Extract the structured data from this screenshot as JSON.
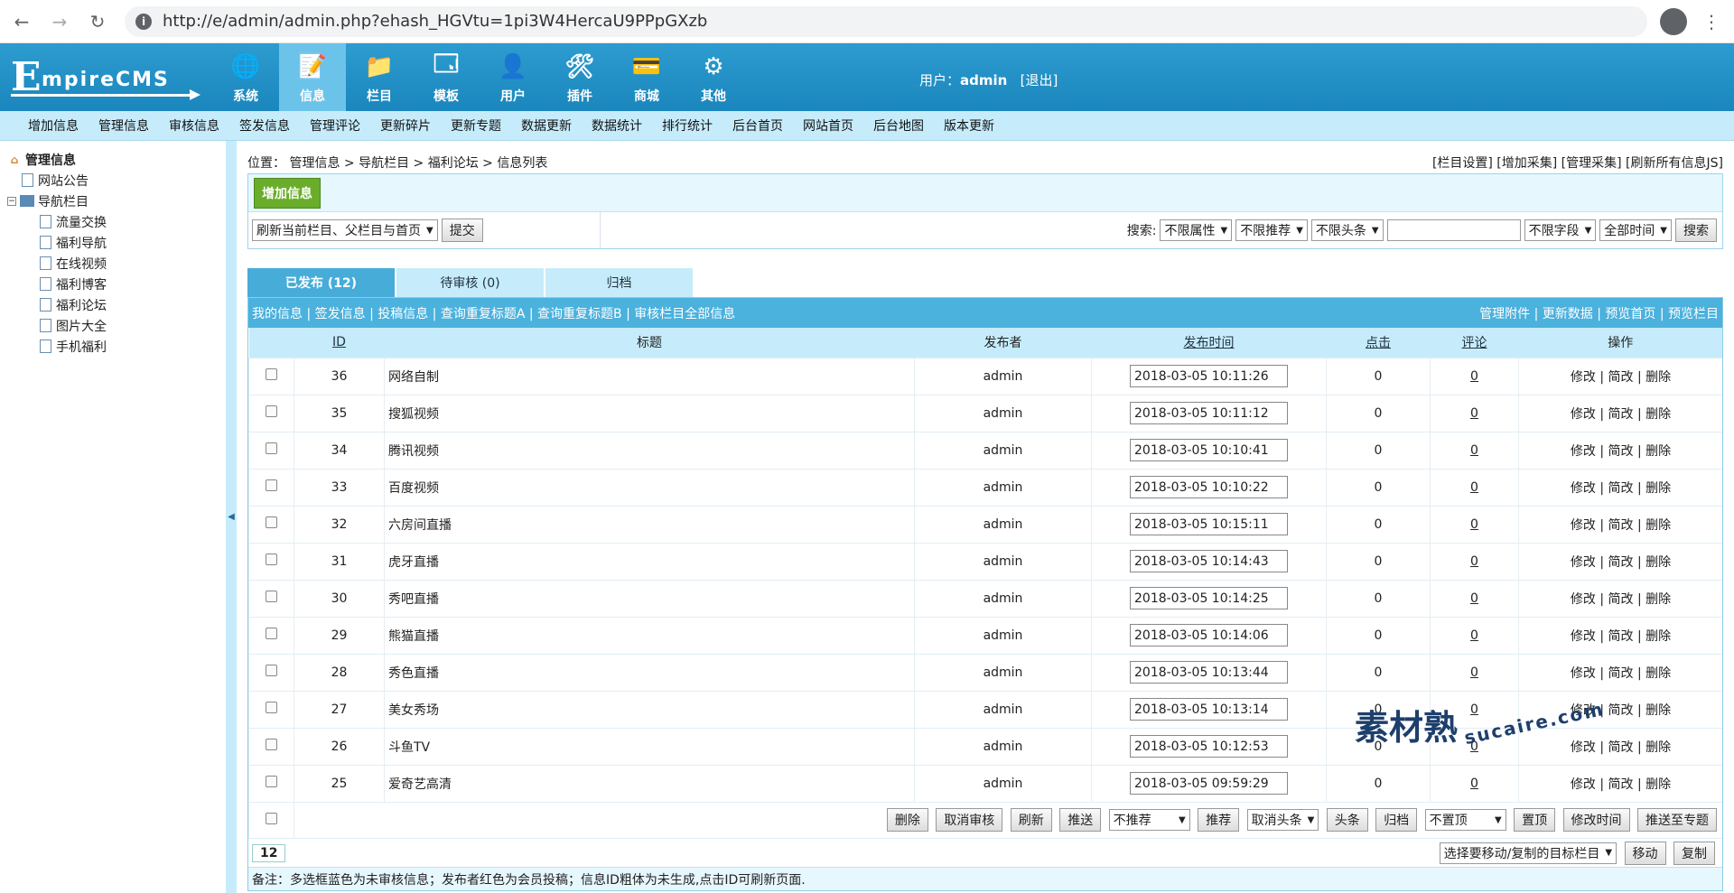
{
  "browser": {
    "url": "http://e/admin/admin.php?ehash_HGVtu=1pi3W4HercaU9PPpGXzb"
  },
  "header": {
    "logo_e": "E",
    "logo_text": "mpireCMS",
    "nav": [
      {
        "label": "系统",
        "icon": "globe-icon",
        "glyph": "🌐"
      },
      {
        "label": "信息",
        "icon": "notepad-icon",
        "glyph": "📝"
      },
      {
        "label": "栏目",
        "icon": "folder-icon",
        "glyph": "📁"
      },
      {
        "label": "模板",
        "icon": "window-icon",
        "glyph": "🗔"
      },
      {
        "label": "用户",
        "icon": "user-icon",
        "glyph": "👤"
      },
      {
        "label": "插件",
        "icon": "tools-icon",
        "glyph": "🛠"
      },
      {
        "label": "商城",
        "icon": "card-icon",
        "glyph": "💳"
      },
      {
        "label": "其他",
        "icon": "gear-icon",
        "glyph": "⚙"
      }
    ],
    "user_label": "用户：",
    "user_name": "admin",
    "logout": "[退出]"
  },
  "submenu": [
    "增加信息",
    "管理信息",
    "审核信息",
    "签发信息",
    "管理评论",
    "更新碎片",
    "更新专题",
    "数据更新",
    "数据统计",
    "排行统计",
    "后台首页",
    "网站首页",
    "后台地图",
    "版本更新"
  ],
  "sidebar": {
    "root": "管理信息",
    "notice": "网站公告",
    "nav_root": "导航栏目",
    "items": [
      "流量交换",
      "福利导航",
      "在线视频",
      "福利博客",
      "福利论坛",
      "图片大全",
      "手机福利"
    ]
  },
  "position": {
    "label": "位置：",
    "path": "管理信息 > 导航栏目 > 福利论坛 > 信息列表",
    "links": "[栏目设置] [增加采集] [管理采集] [刷新所有信息JS]"
  },
  "toolbox": {
    "add_btn": "增加信息",
    "refresh_select": "刷新当前栏目、父栏目与首页",
    "submit": "提交",
    "search_label": "搜索:",
    "filters": [
      "不限属性",
      "不限推荐",
      "不限头条"
    ],
    "field_select": "不限字段",
    "time_select": "全部时间",
    "search_btn": "搜索"
  },
  "tabs": [
    "已发布 (12)",
    "待审核 (0)",
    "归档"
  ],
  "links_left": "我的信息 | 签发信息 | 投稿信息 | 查询重复标题A | 查询重复标题B | 审核栏目全部信息",
  "links_right": "管理附件 | 更新数据 | 预览首页 | 预览栏目",
  "columns": {
    "id": "ID",
    "title": "标题",
    "publisher": "发布者",
    "time": "发布时间",
    "clicks": "点击",
    "comments": "评论",
    "ops": "操作"
  },
  "ops_text": "修改 | 简改 | 删除",
  "rows": [
    {
      "id": "36",
      "title": "网络自制",
      "pub": "admin",
      "time": "2018-03-05 10:11:26",
      "clicks": "0",
      "cmt": "0"
    },
    {
      "id": "35",
      "title": "搜狐视频",
      "pub": "admin",
      "time": "2018-03-05 10:11:12",
      "clicks": "0",
      "cmt": "0"
    },
    {
      "id": "34",
      "title": "腾讯视频",
      "pub": "admin",
      "time": "2018-03-05 10:10:41",
      "clicks": "0",
      "cmt": "0"
    },
    {
      "id": "33",
      "title": "百度视频",
      "pub": "admin",
      "time": "2018-03-05 10:10:22",
      "clicks": "0",
      "cmt": "0"
    },
    {
      "id": "32",
      "title": "六房间直播",
      "pub": "admin",
      "time": "2018-03-05 10:15:11",
      "clicks": "0",
      "cmt": "0"
    },
    {
      "id": "31",
      "title": "虎牙直播",
      "pub": "admin",
      "time": "2018-03-05 10:14:43",
      "clicks": "0",
      "cmt": "0"
    },
    {
      "id": "30",
      "title": "秀吧直播",
      "pub": "admin",
      "time": "2018-03-05 10:14:25",
      "clicks": "0",
      "cmt": "0"
    },
    {
      "id": "29",
      "title": "熊猫直播",
      "pub": "admin",
      "time": "2018-03-05 10:14:06",
      "clicks": "0",
      "cmt": "0"
    },
    {
      "id": "28",
      "title": "秀色直播",
      "pub": "admin",
      "time": "2018-03-05 10:13:44",
      "clicks": "0",
      "cmt": "0"
    },
    {
      "id": "27",
      "title": "美女秀场",
      "pub": "admin",
      "time": "2018-03-05 10:13:14",
      "clicks": "0",
      "cmt": "0"
    },
    {
      "id": "26",
      "title": "斗鱼TV",
      "pub": "admin",
      "time": "2018-03-05 10:12:53",
      "clicks": "0",
      "cmt": "0"
    },
    {
      "id": "25",
      "title": "爱奇艺高清",
      "pub": "admin",
      "time": "2018-03-05 09:59:29",
      "clicks": "0",
      "cmt": "0"
    }
  ],
  "bulk": {
    "delete": "删除",
    "cancel_review": "取消审核",
    "refresh": "刷新",
    "push": "推送",
    "recommend_select": "不推荐",
    "recommend": "推荐",
    "cancel_headline_select": "取消头条",
    "headline": "头条",
    "archive": "归档",
    "top_select": "不置顶",
    "top": "置顶",
    "modify_time": "修改时间",
    "push_topic": "推送至专题"
  },
  "page_no": "12",
  "move": {
    "target_select": "选择要移动/复制的目标栏目",
    "move": "移动",
    "copy": "复制"
  },
  "note": "备注：多选框蓝色为未审核信息；发布者红色为会员投稿；信息ID粗体为未生成,点击ID可刷新页面.",
  "watermark": {
    "main": "素材熟",
    "sub": "sucaire.com"
  }
}
